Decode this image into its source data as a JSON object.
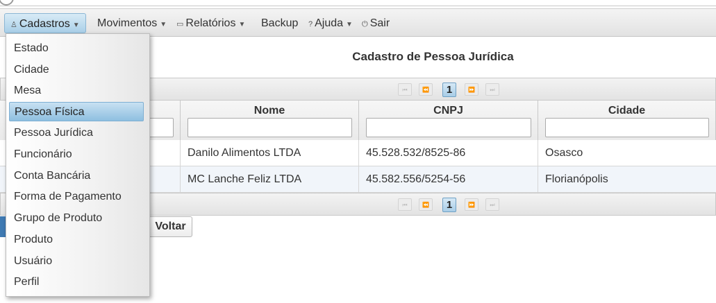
{
  "menubar": {
    "items": [
      {
        "label": "Cadastros",
        "icon": "person-icon",
        "caret": true
      },
      {
        "label": "Movimentos",
        "caret": true
      },
      {
        "label": "Relatórios",
        "icon": "report-icon",
        "caret": true
      },
      {
        "label": "Backup"
      },
      {
        "label": "Ajuda",
        "icon": "help-icon",
        "caret": true
      },
      {
        "label": "Sair",
        "icon": "power-icon"
      }
    ]
  },
  "dropdown": {
    "items": [
      "Estado",
      "Cidade",
      "Mesa",
      "Pessoa Física",
      "Pessoa Jurídica",
      "Funcionário",
      "Conta Bancária",
      "Forma de Pagamento",
      "Grupo de Produto",
      "Produto",
      "Usuário",
      "Perfil"
    ],
    "highlighted": "Pessoa Física"
  },
  "page": {
    "title": "Cadastro de Pessoa Jurídica"
  },
  "paginator": {
    "current_page": "1",
    "first": "⏮",
    "prev": "⏪",
    "next": "⏩",
    "last": "⏭"
  },
  "table": {
    "columns": [
      "Nome",
      "CNPJ",
      "Cidade"
    ],
    "rows": [
      [
        "Danilo Alimentos LTDA",
        "45.528.532/8525-86",
        "Osasco"
      ],
      [
        "MC Lanche Feliz LTDA",
        "45.582.556/5254-56",
        "Florianópolis"
      ]
    ]
  },
  "buttons": {
    "back": "Voltar"
  },
  "colors": {
    "accent": "#a9cfe8",
    "highlight": "#8ebfe0",
    "button_blue": "#3f7ab3"
  }
}
